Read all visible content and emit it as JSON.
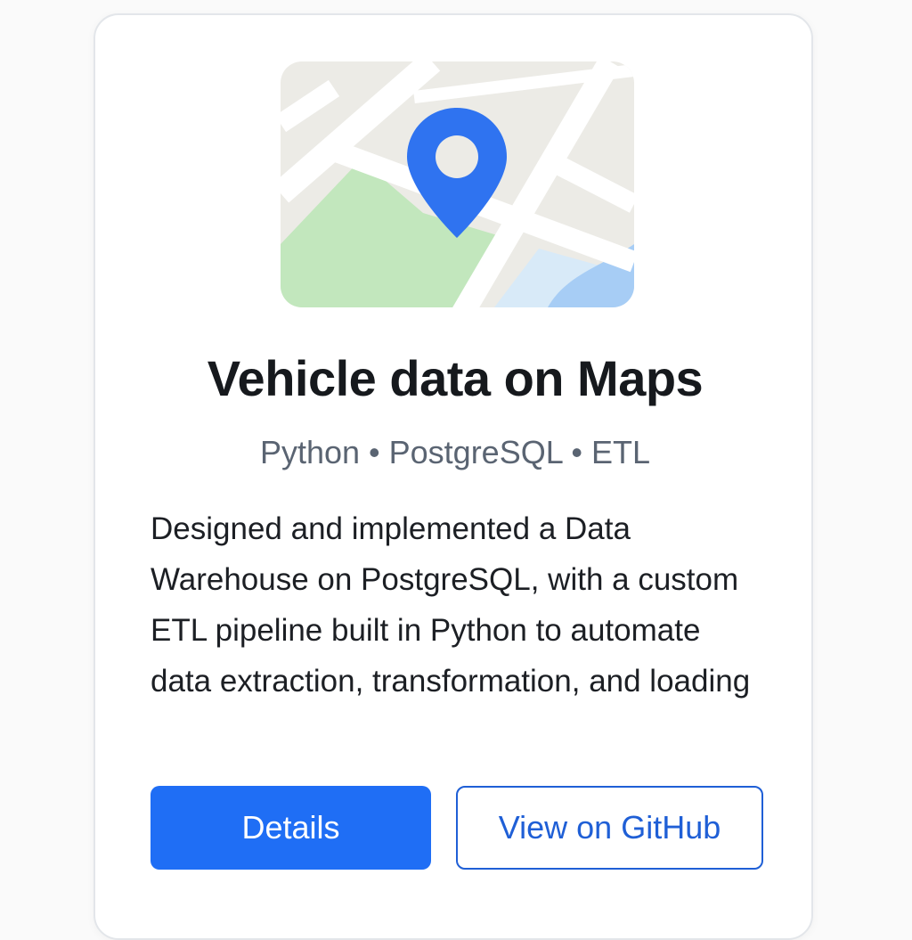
{
  "project": {
    "title": "Vehicle data on Maps",
    "tags": "Python • PostgreSQL • ETL",
    "description": "Designed and implemented a Data Warehouse on PostgreSQL, with a custom ETL pipeline built in Python to automate data extraction, transformation, and loading",
    "thumbnail_icon": "map-pin-icon"
  },
  "actions": {
    "details_label": "Details",
    "github_label": "View on GitHub"
  },
  "colors": {
    "accent": "#1f6ef5",
    "outline": "#1f5fd6",
    "map_land": "#ecebe6",
    "map_park": "#c2e7bd",
    "map_water": "#a7cdf5"
  }
}
